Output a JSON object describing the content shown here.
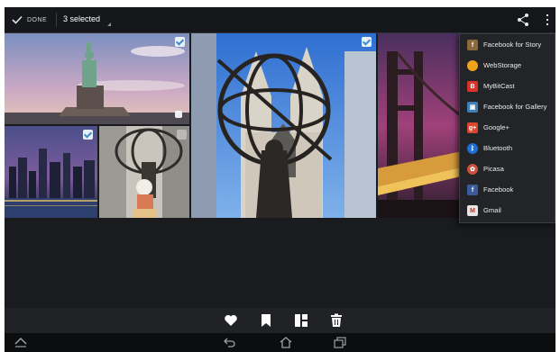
{
  "action_bar": {
    "done_label": "DONE",
    "selected_label": "3 selected",
    "share_icon": "share-icon",
    "overflow_icon": "overflow-menu-icon"
  },
  "photos": [
    {
      "name": "statue-of-liberty",
      "selected": true
    },
    {
      "name": "atlas-statue-cathedral",
      "selected": true
    },
    {
      "name": "golden-gate-bridge-night",
      "selected": false
    },
    {
      "name": "city-skyline-night",
      "selected": true
    },
    {
      "name": "atlas-statue-with-toy",
      "selected": false
    }
  ],
  "share_menu": {
    "items": [
      {
        "label": "Facebook for Story",
        "icon": "facebook-story-icon",
        "color": "#8a6a3a"
      },
      {
        "label": "WebStorage",
        "icon": "webstorage-icon",
        "color": "#f0a21a"
      },
      {
        "label": "MyBitCast",
        "icon": "mybitcast-icon",
        "color": "#d8342c"
      },
      {
        "label": "Facebook for Gallery",
        "icon": "facebook-gallery-icon",
        "color": "#3f7fb8"
      },
      {
        "label": "Google+",
        "icon": "google-plus-icon",
        "color": "#d9472f"
      },
      {
        "label": "Bluetooth",
        "icon": "bluetooth-icon",
        "color": "#1f6fd1"
      },
      {
        "label": "Picasa",
        "icon": "picasa-icon",
        "color": "#c9503b"
      },
      {
        "label": "Facebook",
        "icon": "facebook-icon",
        "color": "#3b5b9c"
      },
      {
        "label": "Gmail",
        "icon": "gmail-icon",
        "color": "#e6e6e6"
      }
    ]
  },
  "toolbar": {
    "buttons": [
      "favorite-icon",
      "bookmark-icon",
      "layout-icon",
      "trash-icon"
    ]
  },
  "navbar": {
    "buttons": [
      "menu-up-icon",
      "back-icon",
      "home-icon",
      "recent-apps-icon"
    ]
  }
}
